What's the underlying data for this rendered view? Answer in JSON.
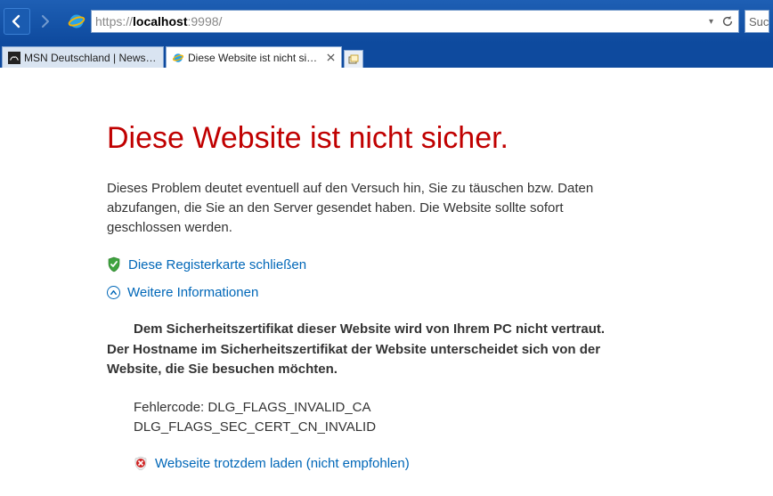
{
  "address": {
    "protocol": "https://",
    "host": "localhost",
    "rest": ":9998/",
    "dropdown_hint": "▾"
  },
  "search": {
    "placeholder": "Such"
  },
  "tabs": [
    {
      "label": "MSN Deutschland | News, Wet...",
      "active": false
    },
    {
      "label": "Diese Website ist nicht sicher.",
      "active": true
    }
  ],
  "page": {
    "title": "Diese Website ist nicht sicher.",
    "description": "Dieses Problem deutet eventuell auf den Versuch hin, Sie zu täuschen bzw. Daten abzufangen, die Sie an den Server gesendet haben. Die Website sollte sofort geschlossen werden.",
    "close_tab": "Diese Registerkarte schließen",
    "more_info": "Weitere Informationen",
    "detail_line1": "Dem Sicherheitszertifikat dieser Website wird von Ihrem PC nicht vertraut.",
    "detail_line2": "Der Hostname im Sicherheitszertifikat der Website unterscheidet sich von der Website, die Sie besuchen möchten.",
    "error_label": "Fehlercode: ",
    "error_code1": "DLG_FLAGS_INVALID_CA",
    "error_code2": "DLG_FLAGS_SEC_CERT_CN_INVALID",
    "proceed": "Webseite trotzdem laden (nicht empfohlen)"
  }
}
